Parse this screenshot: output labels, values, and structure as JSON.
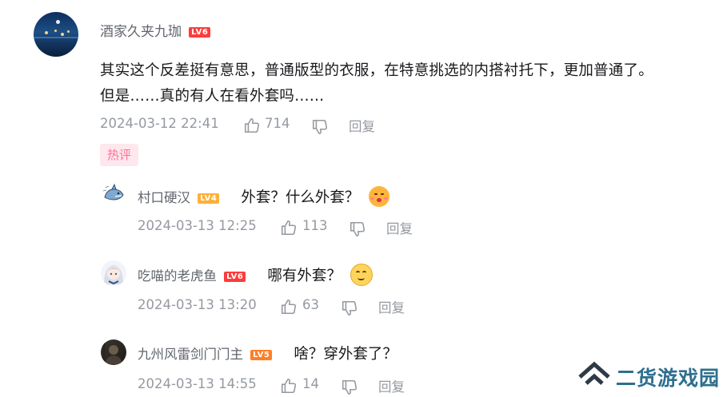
{
  "main_comment": {
    "user_name": "酒家久夹九珈",
    "level": "LV6",
    "text_line1": "其实这个反差挺有意思，普通版型的衣服，在特意挑选的内搭衬托下，更加普通了。",
    "text_line2": "但是……真的有人在看外套吗……",
    "time": "2024-03-12 22:41",
    "likes": "714",
    "reply_label": "回复"
  },
  "hot_tag": "热评",
  "replies": [
    {
      "user_name": "村口硬汉",
      "level": "LV4",
      "text": "外套？什么外套？",
      "emoji": "kiss-face-emoji",
      "time": "2024-03-13 12:25",
      "likes": "113",
      "reply_label": "回复"
    },
    {
      "user_name": "吃喵的老虎鱼",
      "level": "LV6",
      "text": "哪有外套？",
      "emoji": "smile-face-emoji",
      "time": "2024-03-13 13:20",
      "likes": "63",
      "reply_label": "回复"
    },
    {
      "user_name": "九州风雷剑门门主",
      "level": "LV5",
      "text": "啥？穿外套了？",
      "time": "2024-03-13 14:55",
      "likes": "14",
      "reply_label": "回复"
    }
  ],
  "watermark": {
    "text": "二货游戏园"
  },
  "colors": {
    "name_gray": "#61666d",
    "meta_gray": "#9499a0",
    "text_dark": "#18191c",
    "hot_pink": "#fb7299",
    "hot_bg": "#fde8ee",
    "level6": "#ff3b3b",
    "level5": "#ff7f24",
    "level4": "#ffb037",
    "watermark": "#2e6f8f"
  }
}
